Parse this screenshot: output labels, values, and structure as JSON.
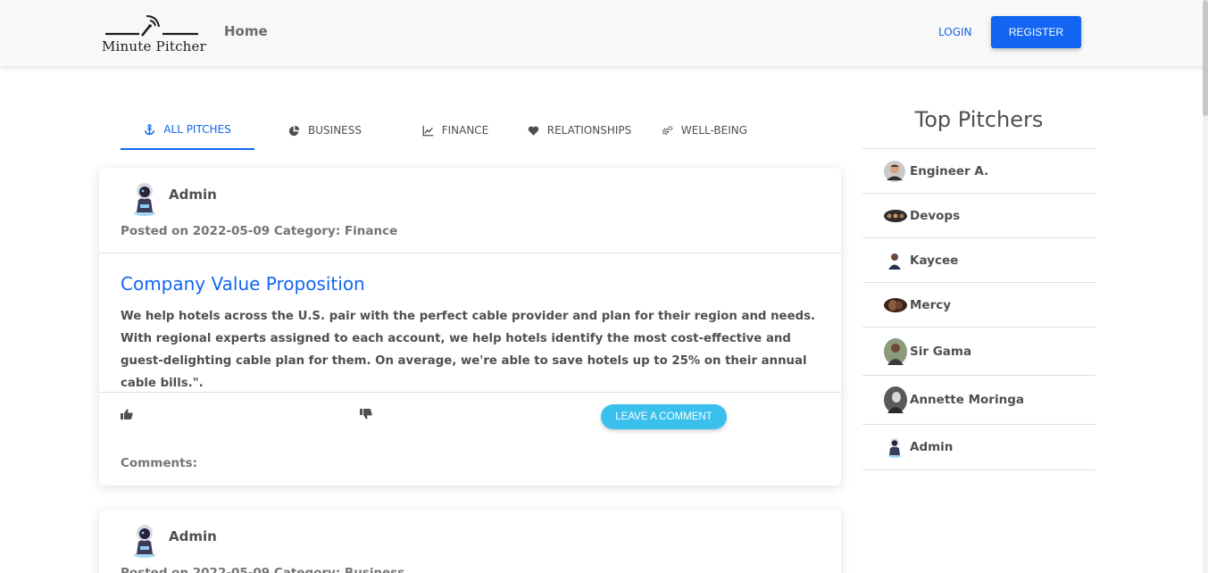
{
  "nav": {
    "logo_text": "Minute Pitcher",
    "home": "Home",
    "login": "LOGIN",
    "register": "REGISTER"
  },
  "tabs": [
    {
      "label": "ALL PITCHES",
      "icon": "anchor-icon",
      "active": true
    },
    {
      "label": "BUSINESS",
      "icon": "pie-chart-icon",
      "active": false
    },
    {
      "label": "FINANCE",
      "icon": "line-chart-icon",
      "active": false
    },
    {
      "label": "RELATIONSHIPS",
      "icon": "heart-icon",
      "active": false
    },
    {
      "label": "WELL-BEING",
      "icon": "gears-icon",
      "active": false
    }
  ],
  "pitches": [
    {
      "author": "Admin",
      "posted": "Posted on 2022-05-09 Category: Finance",
      "title": "Company Value Proposition",
      "body": "We help hotels across the U.S. pair with the perfect cable provider and plan for their region and needs. With regional experts assigned to each account, we help hotels identify the most cost-effective and guest-delighting cable plan for them. On average, we're able to save hotels up to 25% on their annual cable bills.\".",
      "comment_button": "LEAVE A COMMENT",
      "comments_label": "Comments:"
    },
    {
      "author": "Admin",
      "posted": "Posted on 2022-05-09 Category: Business"
    }
  ],
  "sidebar": {
    "title": "Top Pitchers",
    "pitchers": [
      {
        "name": "Engineer A."
      },
      {
        "name": "Devops"
      },
      {
        "name": "Kaycee"
      },
      {
        "name": "Mercy"
      },
      {
        "name": "Sir Gama"
      },
      {
        "name": "Annette Moringa"
      },
      {
        "name": "Admin"
      }
    ]
  },
  "colors": {
    "primary": "#1266f1",
    "info": "#39c0ed",
    "navbar_bg": "#f8f8f8"
  }
}
